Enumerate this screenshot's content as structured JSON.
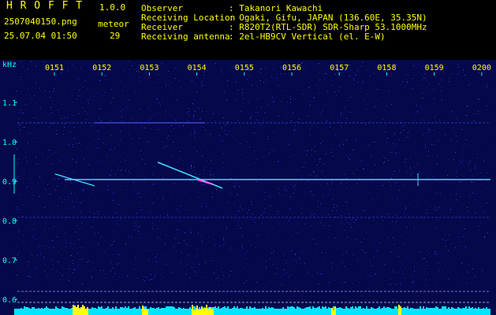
{
  "app": {
    "name": "H R O F F T",
    "version": "1.0.0",
    "filename": "2507040150.png",
    "datetime": "25.07.04 01:50",
    "meteor_label": "meteor",
    "meteor_count": "29"
  },
  "info": {
    "rows": [
      {
        "label": "Observer",
        "value": ": Takanori Kawachi"
      },
      {
        "label": "Receiving Location",
        "value": ": Ogaki, Gifu, JAPAN (136.60E, 35.35N)"
      },
      {
        "label": "Receiver",
        "value": ": R820T2(RTL-SDR) SDR-Sharp 53.1000MHz"
      },
      {
        "label": "Receiving antenna",
        "value": ": 2el-HB9CV Vertical (el. E-W)"
      }
    ]
  },
  "axis": {
    "y_unit": "kHz",
    "time_ticks": [
      "0151",
      "0152",
      "0153",
      "0154",
      "0155",
      "0156",
      "0157",
      "0158",
      "0159",
      "0200"
    ],
    "freq_ticks": [
      "1.1",
      "1.0",
      "0.9",
      "0.8",
      "0.7",
      "0.6"
    ]
  },
  "colors": {
    "background_noise": "#0a0f8a",
    "carrier_line": "#40d8ff",
    "header_yellow": "#ffff00",
    "header_cyan": "#00ffff",
    "bottom_bar": "#00e5ff",
    "bottom_peak": "#ffff00"
  }
}
